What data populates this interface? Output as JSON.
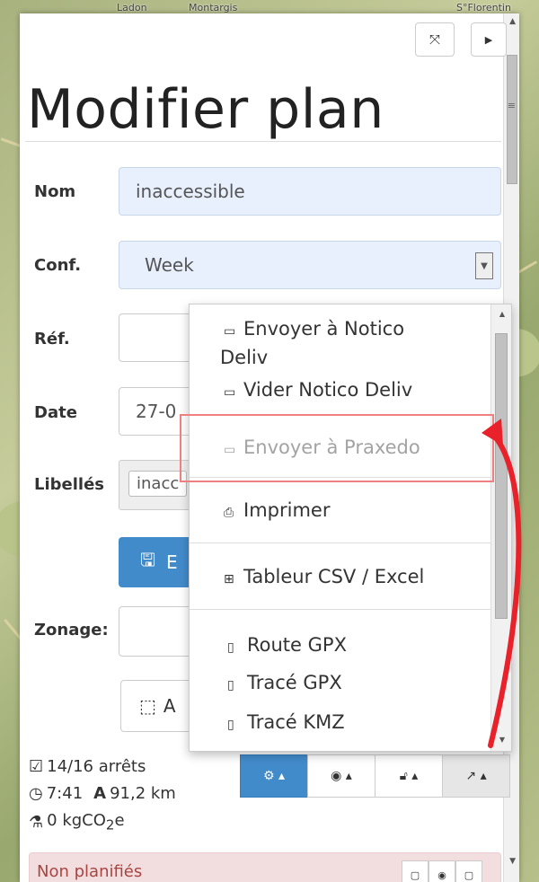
{
  "map": {
    "labels": [
      "Ladon",
      "Montargis",
      "S°Florentin"
    ]
  },
  "panel": {
    "title": "Modifier plan",
    "fields": {
      "nom_label": "Nom",
      "nom_value": "inaccessible",
      "conf_label": "Conf.",
      "conf_value": "Week",
      "ref_label": "Réf.",
      "date_label": "Date",
      "date_value": "27-0",
      "libelles_label": "Libellés",
      "libelles_tag": "inacc",
      "save_label": "E",
      "zonages_label": "Zonage:",
      "area_label": "A"
    },
    "stats": {
      "stops": "14/16 arrêts",
      "duration": "7:41",
      "distance": "91,2 km",
      "co2_prefix": "0 kgCO",
      "co2_sub": "2",
      "co2_suffix": "e"
    },
    "unplanned": "Non planifiés"
  },
  "menu": {
    "items": [
      {
        "line1": "Envoyer à Notico",
        "line2": "Deliv"
      },
      {
        "label": "Vider Notico Deliv"
      },
      {
        "label": "Envoyer à Praxedo"
      },
      {
        "label": "Imprimer"
      },
      {
        "label": "Tableur CSV / Excel"
      },
      {
        "label": "Route GPX"
      },
      {
        "label": "Tracé GPX"
      },
      {
        "label": "Tracé KMZ"
      }
    ]
  },
  "colors": {
    "primary": "#428bca",
    "field_bg": "#e8f0fe",
    "annotation": "#e8212b"
  }
}
